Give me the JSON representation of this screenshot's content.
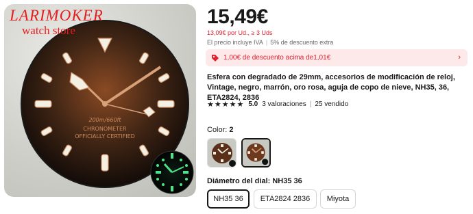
{
  "brand": {
    "name": "LARIMOKER",
    "subtitle": "watch store"
  },
  "dial_text": {
    "depth": "200m/660ft",
    "line1": "CHRONOMETER",
    "line2": "OFFICIALLY CERTIFIED"
  },
  "price": {
    "main": "15,49€",
    "bulk": "13,09€ por Ud., ≥ 3 Uds",
    "tax_note": "El precio incluye IVA",
    "discount_note": "5% de descuento extra"
  },
  "coupon": {
    "text": "1,00€ de descuento acima de1,01€",
    "icon": "tag-icon",
    "arrow_icon": "chevron-right-icon"
  },
  "product": {
    "title": "Esfera con degradado de 29mm, accesorios de modificación de reloj, Vintage, negro, marrón, oro rosa, aguja de copo de nieve, NH35, 36, ETA2824, 2836"
  },
  "rating": {
    "stars": "★★★★★",
    "score": "5.0",
    "reviews": "3 valoraciones",
    "sold": "25 vendido"
  },
  "color": {
    "label": "Color:",
    "value": "2",
    "swatches": [
      "swatch-1",
      "swatch-2"
    ],
    "selected": 1
  },
  "dial_diameter": {
    "label": "Diámetro del dial: NH35 36",
    "options": [
      "NH35 36",
      "ETA2824 2836",
      "Miyota"
    ],
    "selected": 0
  },
  "colors": {
    "accent_red": "#e0202e",
    "coupon_bg": "#fde8ea",
    "text": "#191919"
  }
}
